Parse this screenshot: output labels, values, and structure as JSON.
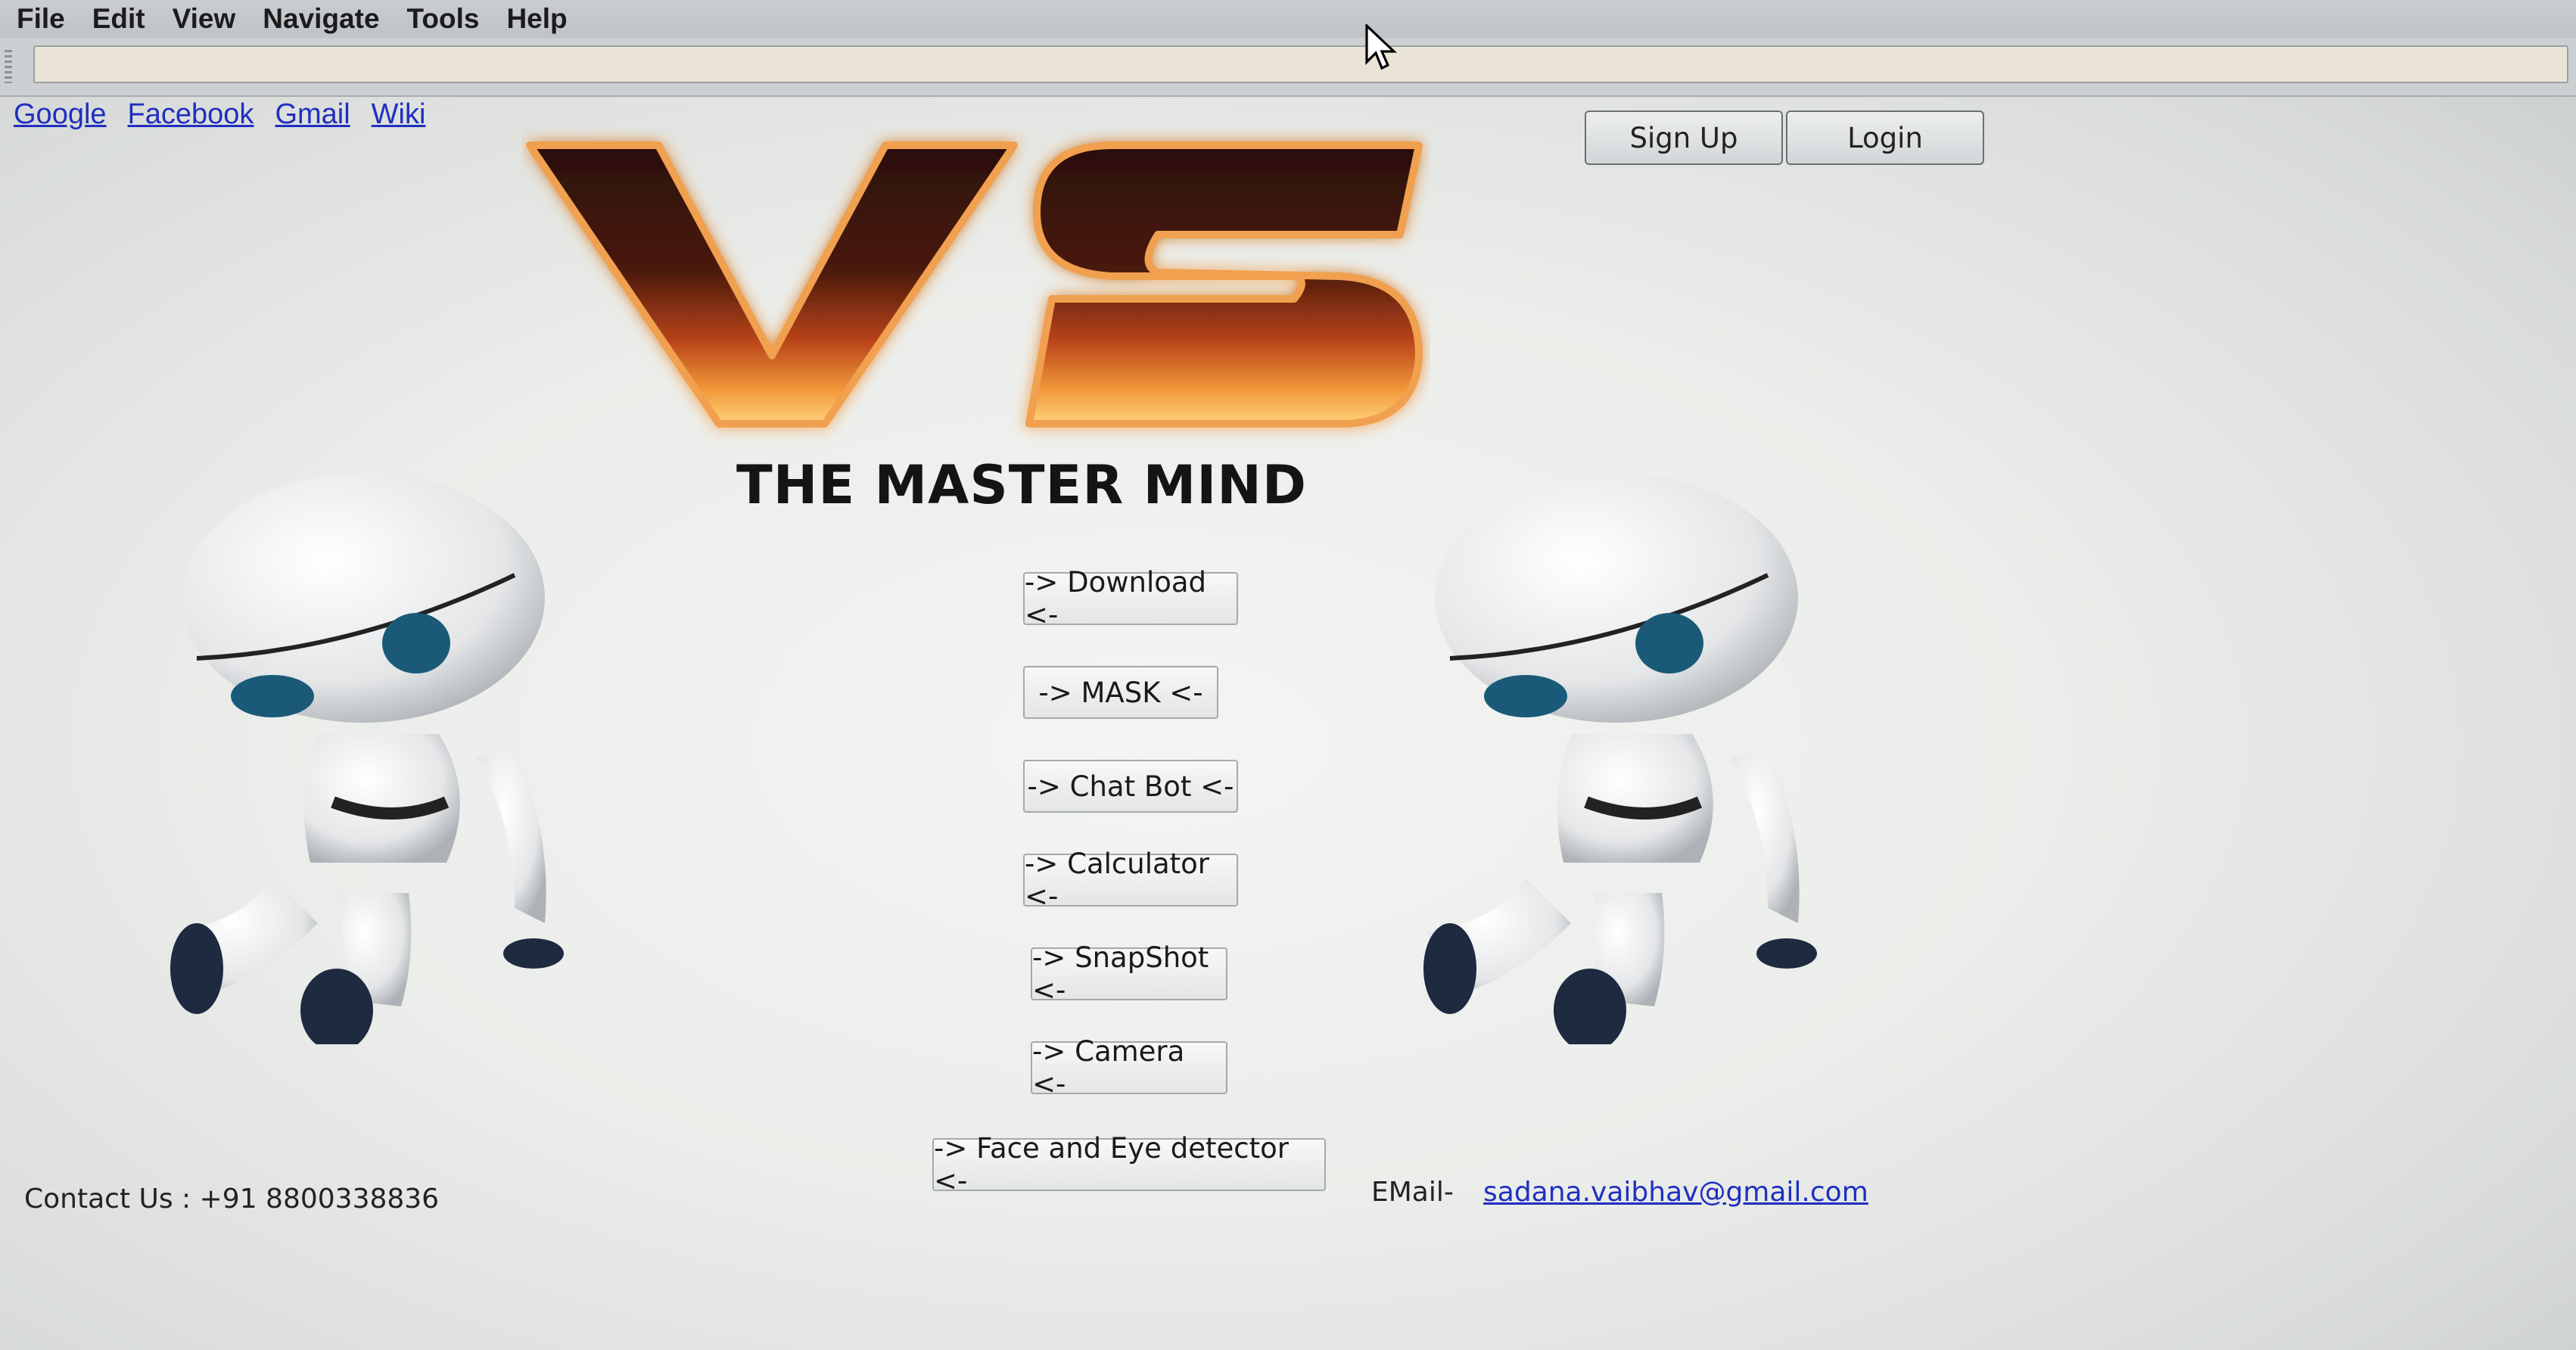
{
  "menubar": {
    "items": [
      {
        "label": "File"
      },
      {
        "label": "Edit"
      },
      {
        "label": "View"
      },
      {
        "label": "Navigate"
      },
      {
        "label": "Tools"
      },
      {
        "label": "Help"
      }
    ]
  },
  "addressbar": {
    "value": ""
  },
  "quicklinks": [
    {
      "label": "Google"
    },
    {
      "label": "Facebook"
    },
    {
      "label": "Gmail"
    },
    {
      "label": "Wiki"
    }
  ],
  "auth": {
    "signup_label": "Sign Up",
    "login_label": "Login"
  },
  "logo": {
    "text": "VS"
  },
  "tagline": "THE MASTER MIND",
  "nav_buttons": [
    {
      "label": "-> Download <-"
    },
    {
      "label": "-> MASK <-"
    },
    {
      "label": "-> Chat Bot <-"
    },
    {
      "label": "-> Calculator <-"
    },
    {
      "label": "-> SnapShot <-"
    },
    {
      "label": "-> Camera <-"
    },
    {
      "label": "-> Face and Eye detector <-"
    }
  ],
  "footer": {
    "contact": "Contact Us : +91 8800338836",
    "email_label": "EMail-",
    "email": "sadana.vaibhav@gmail.com"
  },
  "colors": {
    "link": "#1f2fc0",
    "logo_fire": "#e8731e"
  }
}
